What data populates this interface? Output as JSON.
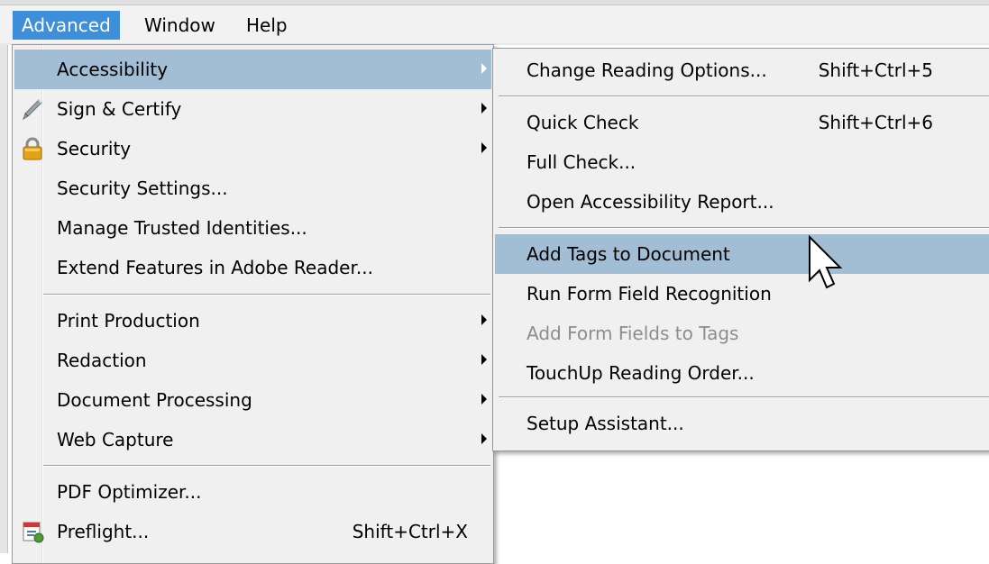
{
  "menubar": {
    "items": [
      {
        "label": "Advanced"
      },
      {
        "label": "Window"
      },
      {
        "label": "Help"
      }
    ]
  },
  "advanced_menu": {
    "items": [
      {
        "label": "Accessibility",
        "submenu": true,
        "highlighted": true
      },
      {
        "label": "Sign & Certify",
        "submenu": true,
        "icon": "pen-icon"
      },
      {
        "label": "Security",
        "submenu": true,
        "icon": "lock-icon"
      },
      {
        "label": "Security Settings..."
      },
      {
        "label": "Manage Trusted Identities..."
      },
      {
        "label": "Extend Features in Adobe Reader..."
      },
      {
        "label": "Print Production",
        "submenu": true
      },
      {
        "label": "Redaction",
        "submenu": true
      },
      {
        "label": "Document Processing",
        "submenu": true
      },
      {
        "label": "Web Capture",
        "submenu": true
      },
      {
        "label": "PDF Optimizer..."
      },
      {
        "label": "Preflight...",
        "shortcut": "Shift+Ctrl+X",
        "icon": "preflight-icon"
      }
    ]
  },
  "accessibility_submenu": {
    "items": [
      {
        "label": "Change Reading Options...",
        "shortcut": "Shift+Ctrl+5"
      },
      {
        "label": "Quick Check",
        "shortcut": "Shift+Ctrl+6"
      },
      {
        "label": "Full Check..."
      },
      {
        "label": "Open Accessibility Report..."
      },
      {
        "label": "Add Tags to Document",
        "highlighted": true
      },
      {
        "label": "Run Form Field Recognition"
      },
      {
        "label": "Add Form Fields to Tags",
        "disabled": true
      },
      {
        "label": "TouchUp Reading Order..."
      },
      {
        "label": "Setup Assistant..."
      }
    ]
  },
  "colors": {
    "menu_bg": "#f0f0f0",
    "highlight": "#a2bed4",
    "menubar_active": "#3c8fd8",
    "disabled_text": "#8d8d8d"
  },
  "cursor": {
    "icon": "arrow-cursor-icon"
  }
}
